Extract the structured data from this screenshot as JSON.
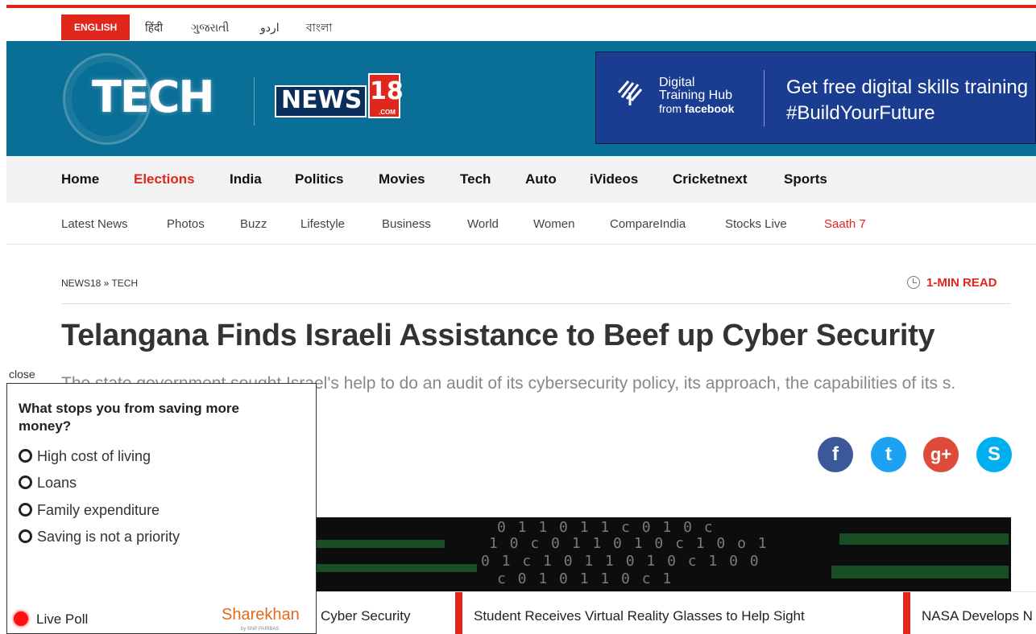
{
  "languages": [
    "ENGLISH",
    "हिंदी",
    "ગુજરાતી",
    "اردو",
    "বাংলা"
  ],
  "brand": {
    "tech": "TECH",
    "news": "NEWS",
    "eighteen": "18",
    "com": ".COM"
  },
  "ad": {
    "line1": "Digital",
    "line2": "Training Hub",
    "line3_from": "from",
    "line3_brand": "facebook",
    "copy1": "Get free digital skills training",
    "copy2": "#BuildYourFuture"
  },
  "main_nav": [
    "Home",
    "Elections",
    "India",
    "Politics",
    "Movies",
    "Tech",
    "Auto",
    "iVideos",
    "Cricketnext",
    "Sports"
  ],
  "sub_nav": [
    "Latest News",
    "Photos",
    "Buzz",
    "Lifestyle",
    "Business",
    "World",
    "Women",
    "CompareIndia",
    "Stocks Live",
    "Saath 7"
  ],
  "article": {
    "breadcrumb": "NEWS18 » TECH",
    "read_time": "1-MIN READ",
    "title": "Telangana Finds Israeli Assistance to Beef up Cyber Security",
    "summary": "The state government sought Israel's help to do an audit of its cybersecurity policy, its approach, the capabilities of its s."
  },
  "share": {
    "facebook": "f",
    "twitter": "t",
    "googleplus": "g+",
    "skype": "S"
  },
  "hero_code": [
    "0 1 1 0 1 1 c 0 1 0 c",
    "1 0 c 0 1 1 0 1 0 c 1 0 o 1",
    "0 1 c 1 0 1 1 0 1 0 c 1 0 0",
    "c 0 1 0 1 1 0 c 1"
  ],
  "poll": {
    "close": "close",
    "question": "What stops you from saving more money?",
    "options": [
      "High cost of living",
      "Loans",
      "Family expenditure",
      "Saving is not a priority"
    ],
    "live_label": "Live Poll",
    "sponsor": "Sharekhan",
    "sponsor_sub": "by BNP PARIBAS"
  },
  "ticker": [
    "Cyber Security",
    "Student Receives Virtual Reality Glasses to Help Sight",
    "NASA Develops N"
  ]
}
